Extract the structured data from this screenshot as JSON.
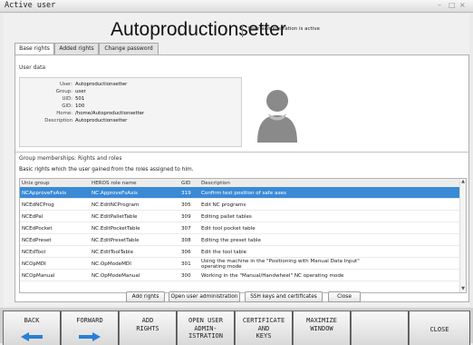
{
  "window": {
    "title": "Active user",
    "controls": [
      "–",
      "□",
      "×"
    ]
  },
  "header": {
    "name": "Autoproductionsetter",
    "status": "User administration is active"
  },
  "tabs": [
    {
      "label": "Base rights"
    },
    {
      "label": "Added rights"
    },
    {
      "label": "Change password"
    }
  ],
  "user_data": {
    "title": "User data",
    "rows": [
      {
        "key": "User:",
        "value": "Autoproductionsetter"
      },
      {
        "key": "Group:",
        "value": "user"
      },
      {
        "key": "UID:",
        "value": "501"
      },
      {
        "key": "GID:",
        "value": "100"
      },
      {
        "key": "Home:",
        "value": "/home/Autoproductionsetter"
      },
      {
        "key": "Description",
        "value": "Autoproductionsetter"
      }
    ]
  },
  "groups": {
    "title": "Group memberships: Rights and roles",
    "info": "Basic rights which the user gained from the roles assigned to him.",
    "columns": [
      "Unix group",
      "HEROS role name",
      "GID",
      "Description"
    ],
    "rows": [
      {
        "unix": "NCApproveFsAxis",
        "role": "NC.ApproveFsAxis",
        "gid": "319",
        "desc": "Confirm test position of safe axes",
        "selected": true
      },
      {
        "unix": "NCEdNCProg",
        "role": "NC.EditNCProgram",
        "gid": "305",
        "desc": "Edit NC programs"
      },
      {
        "unix": "NCEdPal",
        "role": "NC.EditPalletTable",
        "gid": "309",
        "desc": "Editing pallet tables"
      },
      {
        "unix": "NCEdPocket",
        "role": "NC.EditPocketTable",
        "gid": "307",
        "desc": "Edit tool pocket table"
      },
      {
        "unix": "NCEdPreset",
        "role": "NC.EditPresetTable",
        "gid": "308",
        "desc": "Editing the preset table"
      },
      {
        "unix": "NCEdTool",
        "role": "NC.EditToolTable",
        "gid": "306",
        "desc": "Edit the tool table"
      },
      {
        "unix": "NCOpMDI",
        "role": "NC.OpModeMDI",
        "gid": "301",
        "desc": "Using the machine in the \"Positioning with Manual Data Input\" operating mode"
      },
      {
        "unix": "NCOpManual",
        "role": "NC.OpModeManual",
        "gid": "300",
        "desc": "Working in the \"Manual/Handwheel\" NC operating mode"
      }
    ]
  },
  "buttons": {
    "add_rights": "Add rights",
    "open_admin": "Open user administration",
    "ssh": "SSH keys and certificates",
    "close": "Close"
  },
  "softkeys": [
    {
      "label": "BACK",
      "icon": "arrow-left-icon"
    },
    {
      "label": "FORWARD",
      "icon": "arrow-right-icon"
    },
    {
      "label": "ADD\nRIGHTS"
    },
    {
      "label": "OPEN USER\nADMIN-\nISTRATION"
    },
    {
      "label": "CERTIFICATE\nAND\nKEYS"
    },
    {
      "label": "MAXIMIZE\nWINDOW"
    },
    {
      "label": ""
    },
    {
      "label": "CLOSE"
    }
  ],
  "colors": {
    "selection": "#3a8ad6",
    "arrow": "#2a7fd4"
  }
}
